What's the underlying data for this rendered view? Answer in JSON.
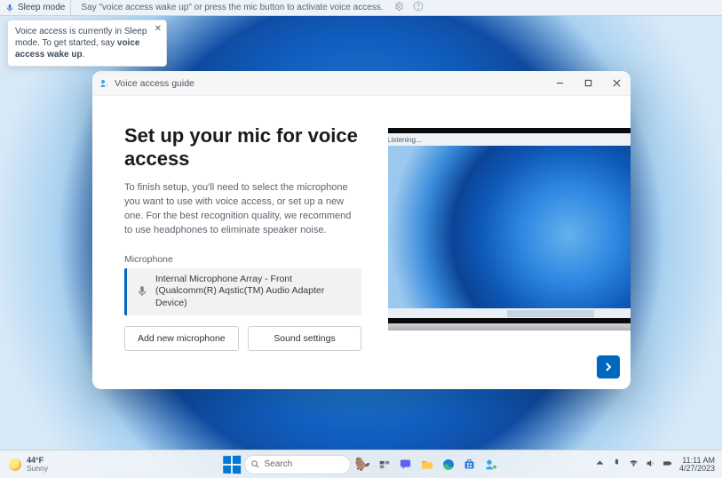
{
  "va_bar": {
    "mode": "Sleep mode",
    "hint": "Say \"voice access wake up\" or press the mic button to activate voice access."
  },
  "va_tip": {
    "line1": "Voice access is currently in Sleep mode. To get started, say ",
    "bold": "voice access wake up",
    "tail": "."
  },
  "window": {
    "title": "Voice access guide",
    "heading": "Set up your mic for voice access",
    "desc": "To finish setup, you'll need to select the microphone you want to use with voice access, or set up a new one. For the best recognition quality, we recommend to use headphones to eliminate speaker noise.",
    "mic_label": "Microphone",
    "mic_name": "Internal Microphone Array - Front (Qualcomm(R) Aqstic(TM) Audio Adapter Device)",
    "add_mic": "Add new microphone",
    "sound_settings": "Sound settings",
    "listening": "Listening..."
  },
  "taskbar": {
    "temp": "44°F",
    "cond": "Sunny",
    "search": "Search",
    "time": "11:11 AM",
    "date": "4/27/2023"
  }
}
